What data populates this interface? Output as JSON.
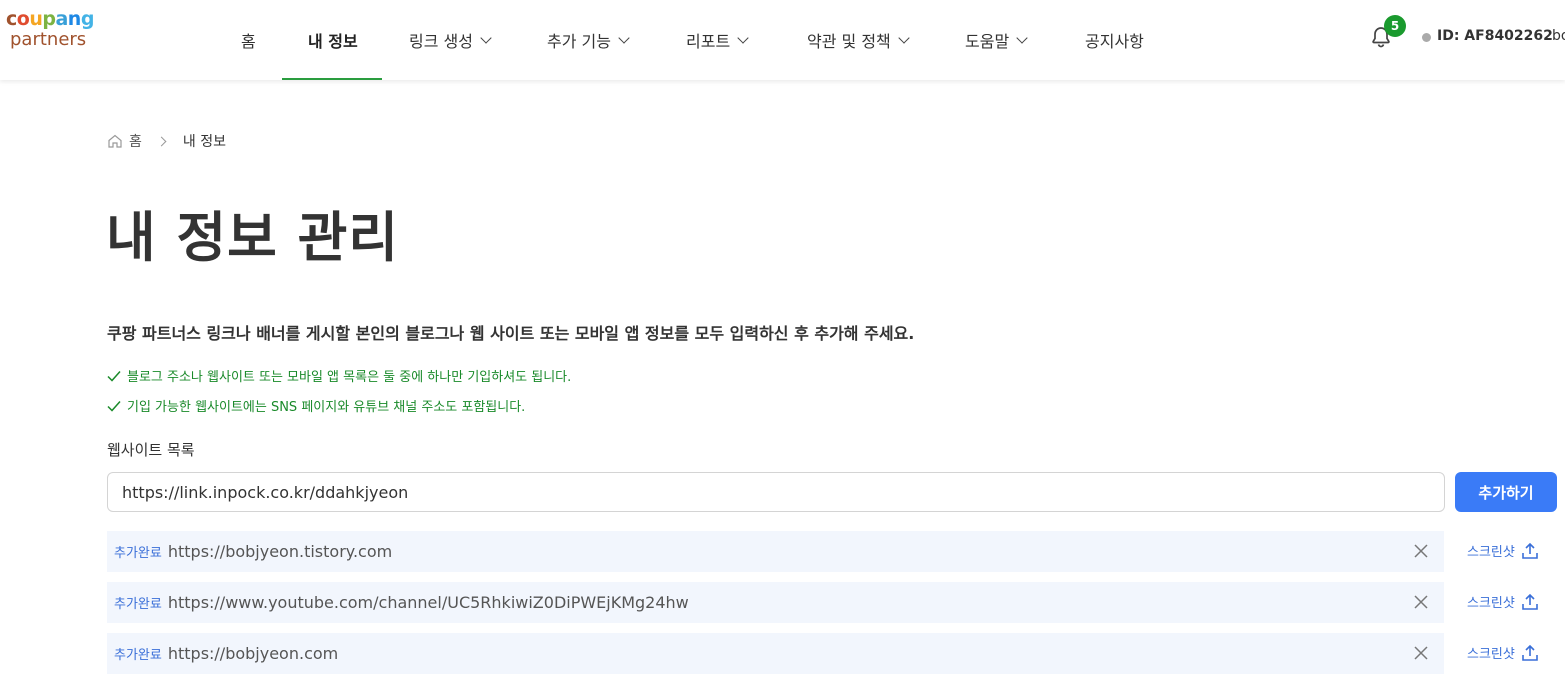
{
  "brand": {
    "logo_top": "coupang",
    "logo_bottom": "partners",
    "logo_colors": [
      "#a0522d",
      "#e04c2f",
      "#f5a623",
      "#7cb342",
      "#39a0d8",
      "#1e88e5",
      "#43b3e6"
    ]
  },
  "nav": {
    "items": [
      {
        "label": "홈",
        "dropdown": false,
        "active": false
      },
      {
        "label": "내 정보",
        "dropdown": false,
        "active": true
      },
      {
        "label": "링크 생성",
        "dropdown": true,
        "active": false
      },
      {
        "label": "추가 기능",
        "dropdown": true,
        "active": false
      },
      {
        "label": "리포트",
        "dropdown": true,
        "active": false
      },
      {
        "label": "약관 및 정책",
        "dropdown": true,
        "active": false
      },
      {
        "label": "도움말",
        "dropdown": true,
        "active": false
      },
      {
        "label": "공지사항",
        "dropdown": false,
        "active": false
      }
    ],
    "active_color": "#2a9d3f"
  },
  "header": {
    "notification_count": "5",
    "user_id": "ID: AF8402262",
    "user_extra": "bo"
  },
  "breadcrumb": {
    "home": "홈",
    "current": "내 정보"
  },
  "page": {
    "title": "내 정보 관리",
    "intro": "쿠팡 파트너스 링크나 배너를 게시할 본인의 블로그나 웹 사이트 또는 모바일 앱 정보를 모두 입력하신 후 추가해 주세요.",
    "notes": [
      "블로그 주소나 웹사이트 또는 모바일 앱 목록은 둘 중에 하나만 기입하셔도 됩니다.",
      "기입 가능한 웹사이트에는 SNS 페이지와 유튜브 채널 주소도 포함됩니다."
    ],
    "section_label": "웹사이트 목록",
    "input_value": "https://link.inpock.co.kr/ddahkjyeon",
    "add_label": "추가하기",
    "accent_color": "#3a7bf7",
    "note_color": "#1a8a2a"
  },
  "sites": [
    {
      "tag": "추가완료",
      "url": "https://bobjyeon.tistory.com",
      "screenshot_label": "스크린샷"
    },
    {
      "tag": "추가완료",
      "url": "https://www.youtube.com/channel/UC5RhkiwiZ0DiPWEjKMg24hw",
      "screenshot_label": "스크린샷"
    },
    {
      "tag": "추가완료",
      "url": "https://bobjyeon.com",
      "screenshot_label": "스크린샷"
    }
  ]
}
